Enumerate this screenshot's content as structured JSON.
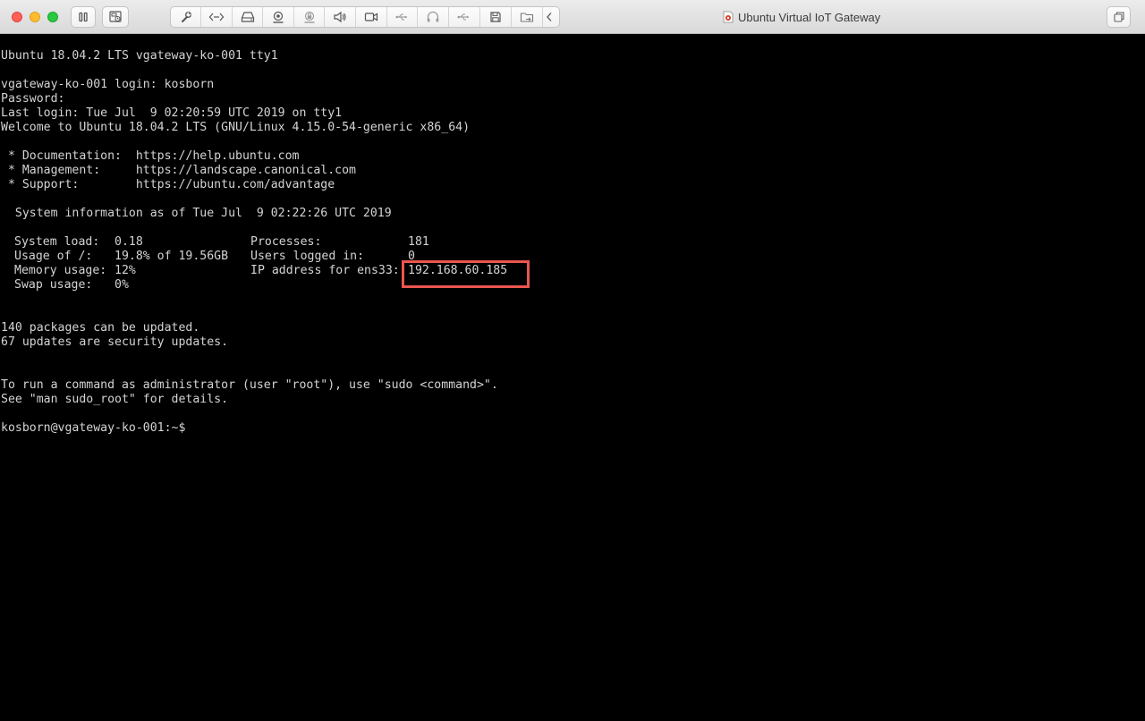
{
  "window": {
    "title": "Ubuntu Virtual IoT Gateway",
    "colors": {
      "close": "#ff5f57",
      "minimize": "#febc2e",
      "maximize": "#28c840",
      "highlight": "#e9564e"
    }
  },
  "toolbar": {
    "left_buttons": [
      "pause-icon",
      "snapshot-icon"
    ],
    "items": [
      "wrench-icon",
      "code-icon",
      "hard-disk-icon",
      "camera-icon",
      "lock-icon",
      "speaker-icon",
      "video-icon",
      "usb-icon",
      "headphones-icon",
      "usb-icon",
      "floppy-icon",
      "shared-folder-icon",
      "chevron-left-icon"
    ],
    "right_button": "fullscreen-icon"
  },
  "console": {
    "banner": "Ubuntu 18.04.2 LTS vgateway-ko-001 tty1",
    "login_prompt": "vgateway-ko-001 login: kosborn",
    "password_prompt": "Password:",
    "last_login": "Last login: Tue Jul  9 02:20:59 UTC 2019 on tty1",
    "welcome": "Welcome to Ubuntu 18.04.2 LTS (GNU/Linux 4.15.0-54-generic x86_64)",
    "links": [
      " * Documentation:  https://help.ubuntu.com",
      " * Management:     https://landscape.canonical.com",
      " * Support:        https://ubuntu.com/advantage"
    ],
    "sysinfo_header": "  System information as of Tue Jul  9 02:22:26 UTC 2019",
    "stats": {
      "system_load_label": "System load:",
      "system_load": "0.18",
      "usage_label": "Usage of /:",
      "usage": "19.8% of 19.56GB",
      "memory_label": "Memory usage:",
      "memory": "12%",
      "swap_label": "Swap usage:",
      "swap": "0%",
      "processes_label": "Processes:",
      "processes": "181",
      "users_label": "Users logged in:",
      "users": "0",
      "ip_label": "IP address for ens33:",
      "ip": "192.168.60.185"
    },
    "updates": [
      "140 packages can be updated.",
      "67 updates are security updates."
    ],
    "sudo_hint": [
      "To run a command as administrator (user \"root\"), use \"sudo <command>\".",
      "See \"man sudo_root\" for details."
    ],
    "shell_prompt": "kosborn@vgateway-ko-001:~$"
  }
}
